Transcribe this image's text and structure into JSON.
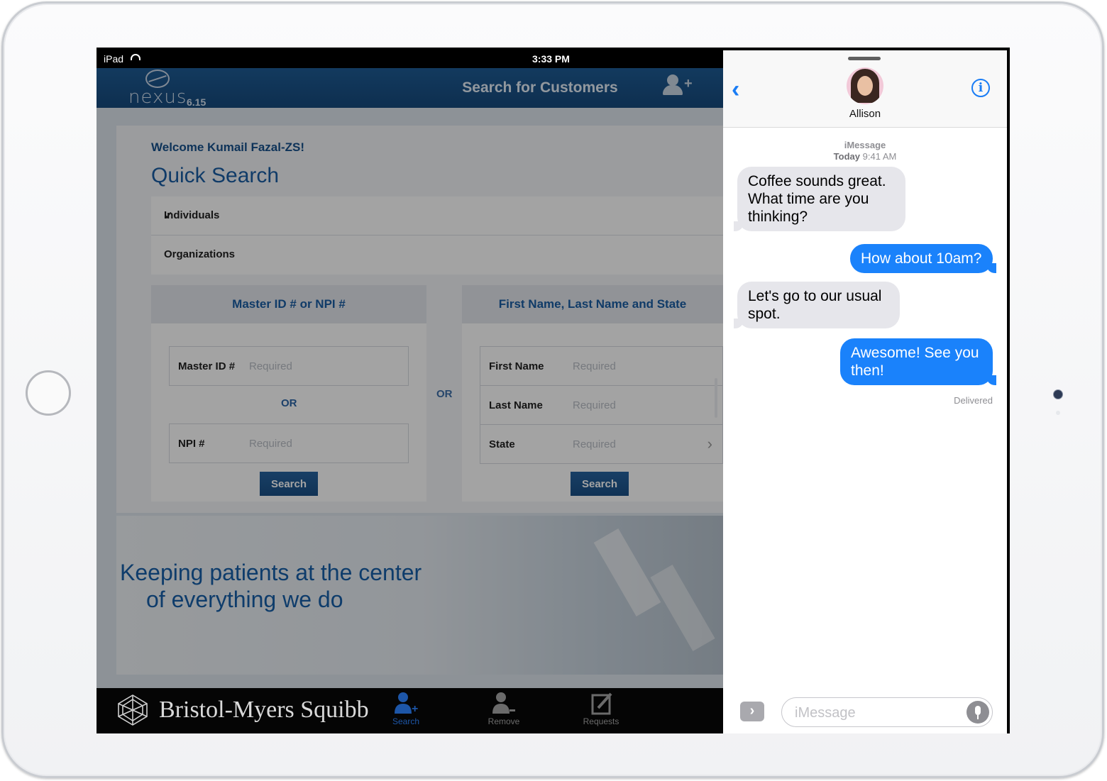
{
  "device": {
    "name": "iPad",
    "time": "3:33 PM"
  },
  "app": {
    "logo_word": "nexus",
    "version": "6.15",
    "title": "Search for Customers",
    "welcome": "Welcome Kumail Fazal-ZS!",
    "quick_search": "Quick Search",
    "segments": [
      {
        "label": "Individuals",
        "selected": true
      },
      {
        "label": "Organizations",
        "selected": false
      }
    ],
    "or_label": "OR",
    "panel_id": {
      "header": "Master ID # or NPI #",
      "master_label": "Master ID #",
      "master_placeholder": "Required",
      "or_label": "OR",
      "npi_label": "NPI #",
      "npi_placeholder": "Required",
      "button": "Search"
    },
    "panel_name": {
      "header": "First Name, Last Name and State",
      "first_label": "First Name",
      "first_placeholder": "Required",
      "last_label": "Last Name",
      "last_placeholder": "Required",
      "state_label": "State",
      "state_placeholder": "Required",
      "button": "Search"
    },
    "banner": {
      "line1": "Keeping patients at the center",
      "line2": "of everything we do"
    },
    "footer": {
      "brand": "Bristol-Myers Squibb",
      "tabs": [
        {
          "label": "Search",
          "icon": "add-person-icon",
          "active": true
        },
        {
          "label": "Remove",
          "icon": "remove-person-icon",
          "active": false
        },
        {
          "label": "Requests",
          "icon": "compose-icon",
          "active": false
        }
      ]
    },
    "colors": {
      "primary": "#1a5da3",
      "appbar": "#164a7d",
      "active_tab": "#1d56a8"
    }
  },
  "messages": {
    "contact": "Allison",
    "service": "iMessage",
    "date": "Today",
    "time": "9:41 AM",
    "thread": [
      {
        "from": "them",
        "text": "Coffee sounds great. What time are you thinking?"
      },
      {
        "from": "me",
        "text": "How about 10am?"
      },
      {
        "from": "them",
        "text": "Let's go to our usual spot."
      },
      {
        "from": "me",
        "text": "Awesome! See you then!"
      }
    ],
    "status": "Delivered",
    "input_placeholder": "iMessage",
    "colors": {
      "outgoing": "#1a82fb",
      "incoming": "#e6e6eb",
      "tint": "#1a7df5"
    }
  }
}
